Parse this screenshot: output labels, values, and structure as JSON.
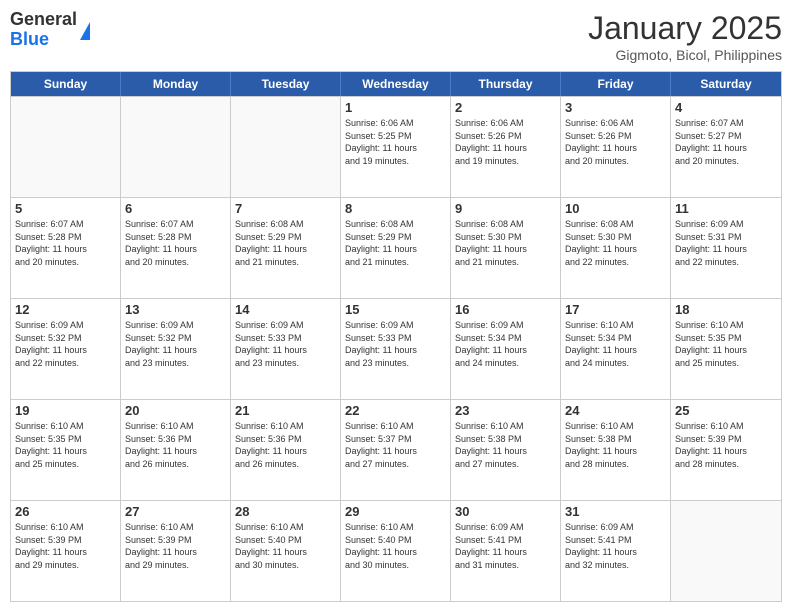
{
  "logo": {
    "general": "General",
    "blue": "Blue"
  },
  "title": "January 2025",
  "subtitle": "Gigmoto, Bicol, Philippines",
  "headers": [
    "Sunday",
    "Monday",
    "Tuesday",
    "Wednesday",
    "Thursday",
    "Friday",
    "Saturday"
  ],
  "weeks": [
    [
      {
        "day": "",
        "info": ""
      },
      {
        "day": "",
        "info": ""
      },
      {
        "day": "",
        "info": ""
      },
      {
        "day": "1",
        "info": "Sunrise: 6:06 AM\nSunset: 5:25 PM\nDaylight: 11 hours\nand 19 minutes."
      },
      {
        "day": "2",
        "info": "Sunrise: 6:06 AM\nSunset: 5:26 PM\nDaylight: 11 hours\nand 19 minutes."
      },
      {
        "day": "3",
        "info": "Sunrise: 6:06 AM\nSunset: 5:26 PM\nDaylight: 11 hours\nand 20 minutes."
      },
      {
        "day": "4",
        "info": "Sunrise: 6:07 AM\nSunset: 5:27 PM\nDaylight: 11 hours\nand 20 minutes."
      }
    ],
    [
      {
        "day": "5",
        "info": "Sunrise: 6:07 AM\nSunset: 5:28 PM\nDaylight: 11 hours\nand 20 minutes."
      },
      {
        "day": "6",
        "info": "Sunrise: 6:07 AM\nSunset: 5:28 PM\nDaylight: 11 hours\nand 20 minutes."
      },
      {
        "day": "7",
        "info": "Sunrise: 6:08 AM\nSunset: 5:29 PM\nDaylight: 11 hours\nand 21 minutes."
      },
      {
        "day": "8",
        "info": "Sunrise: 6:08 AM\nSunset: 5:29 PM\nDaylight: 11 hours\nand 21 minutes."
      },
      {
        "day": "9",
        "info": "Sunrise: 6:08 AM\nSunset: 5:30 PM\nDaylight: 11 hours\nand 21 minutes."
      },
      {
        "day": "10",
        "info": "Sunrise: 6:08 AM\nSunset: 5:30 PM\nDaylight: 11 hours\nand 22 minutes."
      },
      {
        "day": "11",
        "info": "Sunrise: 6:09 AM\nSunset: 5:31 PM\nDaylight: 11 hours\nand 22 minutes."
      }
    ],
    [
      {
        "day": "12",
        "info": "Sunrise: 6:09 AM\nSunset: 5:32 PM\nDaylight: 11 hours\nand 22 minutes."
      },
      {
        "day": "13",
        "info": "Sunrise: 6:09 AM\nSunset: 5:32 PM\nDaylight: 11 hours\nand 23 minutes."
      },
      {
        "day": "14",
        "info": "Sunrise: 6:09 AM\nSunset: 5:33 PM\nDaylight: 11 hours\nand 23 minutes."
      },
      {
        "day": "15",
        "info": "Sunrise: 6:09 AM\nSunset: 5:33 PM\nDaylight: 11 hours\nand 23 minutes."
      },
      {
        "day": "16",
        "info": "Sunrise: 6:09 AM\nSunset: 5:34 PM\nDaylight: 11 hours\nand 24 minutes."
      },
      {
        "day": "17",
        "info": "Sunrise: 6:10 AM\nSunset: 5:34 PM\nDaylight: 11 hours\nand 24 minutes."
      },
      {
        "day": "18",
        "info": "Sunrise: 6:10 AM\nSunset: 5:35 PM\nDaylight: 11 hours\nand 25 minutes."
      }
    ],
    [
      {
        "day": "19",
        "info": "Sunrise: 6:10 AM\nSunset: 5:35 PM\nDaylight: 11 hours\nand 25 minutes."
      },
      {
        "day": "20",
        "info": "Sunrise: 6:10 AM\nSunset: 5:36 PM\nDaylight: 11 hours\nand 26 minutes."
      },
      {
        "day": "21",
        "info": "Sunrise: 6:10 AM\nSunset: 5:36 PM\nDaylight: 11 hours\nand 26 minutes."
      },
      {
        "day": "22",
        "info": "Sunrise: 6:10 AM\nSunset: 5:37 PM\nDaylight: 11 hours\nand 27 minutes."
      },
      {
        "day": "23",
        "info": "Sunrise: 6:10 AM\nSunset: 5:38 PM\nDaylight: 11 hours\nand 27 minutes."
      },
      {
        "day": "24",
        "info": "Sunrise: 6:10 AM\nSunset: 5:38 PM\nDaylight: 11 hours\nand 28 minutes."
      },
      {
        "day": "25",
        "info": "Sunrise: 6:10 AM\nSunset: 5:39 PM\nDaylight: 11 hours\nand 28 minutes."
      }
    ],
    [
      {
        "day": "26",
        "info": "Sunrise: 6:10 AM\nSunset: 5:39 PM\nDaylight: 11 hours\nand 29 minutes."
      },
      {
        "day": "27",
        "info": "Sunrise: 6:10 AM\nSunset: 5:39 PM\nDaylight: 11 hours\nand 29 minutes."
      },
      {
        "day": "28",
        "info": "Sunrise: 6:10 AM\nSunset: 5:40 PM\nDaylight: 11 hours\nand 30 minutes."
      },
      {
        "day": "29",
        "info": "Sunrise: 6:10 AM\nSunset: 5:40 PM\nDaylight: 11 hours\nand 30 minutes."
      },
      {
        "day": "30",
        "info": "Sunrise: 6:09 AM\nSunset: 5:41 PM\nDaylight: 11 hours\nand 31 minutes."
      },
      {
        "day": "31",
        "info": "Sunrise: 6:09 AM\nSunset: 5:41 PM\nDaylight: 11 hours\nand 32 minutes."
      },
      {
        "day": "",
        "info": ""
      }
    ]
  ]
}
